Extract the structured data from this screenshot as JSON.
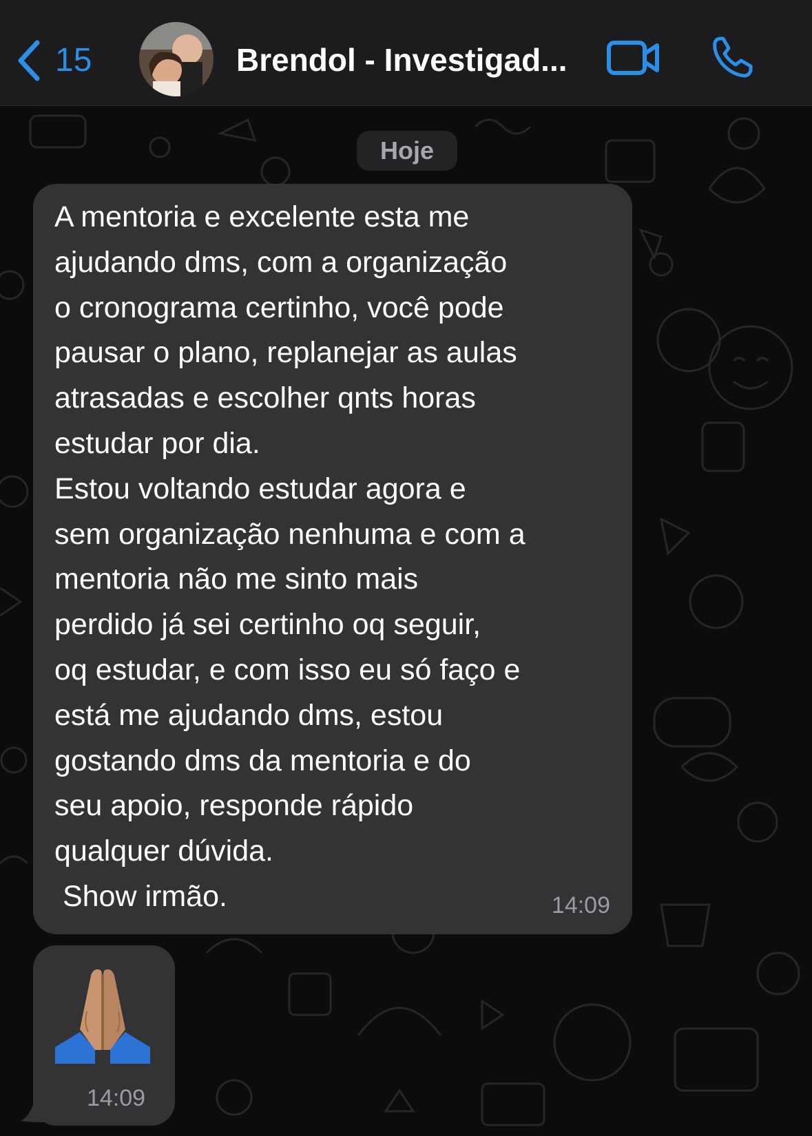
{
  "header": {
    "back_count": "15",
    "contact_name": "Brendol - Investigad...",
    "back_icon": "chevron-left-icon",
    "video_icon": "video-camera-icon",
    "call_icon": "phone-icon"
  },
  "chat": {
    "date_separator": "Hoje",
    "messages": [
      {
        "text": "A mentoria e excelente esta me\najudando dms, com a organização\no cronograma certinho, você pode\npausar o plano, replanejar as aulas\natrasadas e escolher qnts horas\nestudar por dia.\nEstou voltando estudar agora e\nsem organização nenhuma e com a\nmentoria não me sinto mais\nperdido já sei certinho oq seguir,\noq estudar, e com isso eu só faço e\nestá me ajudando dms, estou\ngostando dms da mentoria e do\nseu apoio, responde rápido\nqualquer dúvida.\n Show irmão.",
        "time": "14:09"
      },
      {
        "emoji": "folded-hands-icon",
        "time": "14:09"
      }
    ]
  },
  "colors": {
    "accent": "#2a8fe6",
    "header_bg": "#1c1c1e",
    "bubble_bg": "#333335",
    "chat_bg": "#0c0c0c"
  }
}
